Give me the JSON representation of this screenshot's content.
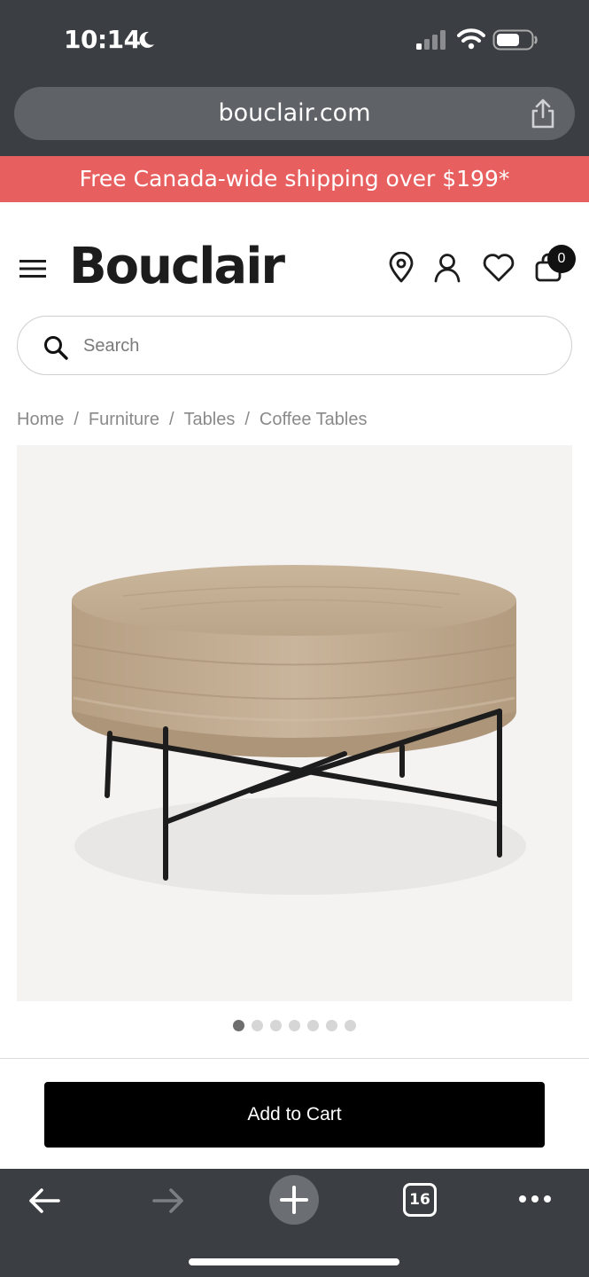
{
  "status_bar": {
    "time": "10:14"
  },
  "browser": {
    "url": "bouclair.com",
    "tab_count": "16"
  },
  "promo": {
    "text": "Free Canada-wide shipping over $199*"
  },
  "header": {
    "logo": "Bouclair",
    "cart_count": "0"
  },
  "search": {
    "placeholder": "Search"
  },
  "breadcrumb": {
    "items": [
      "Home",
      "Furniture",
      "Tables",
      "Coffee Tables"
    ],
    "separator": "/"
  },
  "gallery": {
    "total_images": 7,
    "active_index": 0
  },
  "product": {
    "add_to_cart_label": "Add to Cart"
  },
  "colors": {
    "chrome": "#3b3e42",
    "promo_bg": "#e85f5f",
    "button_bg": "#000000"
  },
  "icons": [
    "moon-icon",
    "signal-icon",
    "wifi-icon",
    "battery-icon",
    "share-icon",
    "menu-icon",
    "location-icon",
    "account-icon",
    "heart-icon",
    "bag-icon",
    "search-icon",
    "back-icon",
    "forward-icon",
    "plus-icon",
    "more-icon"
  ]
}
